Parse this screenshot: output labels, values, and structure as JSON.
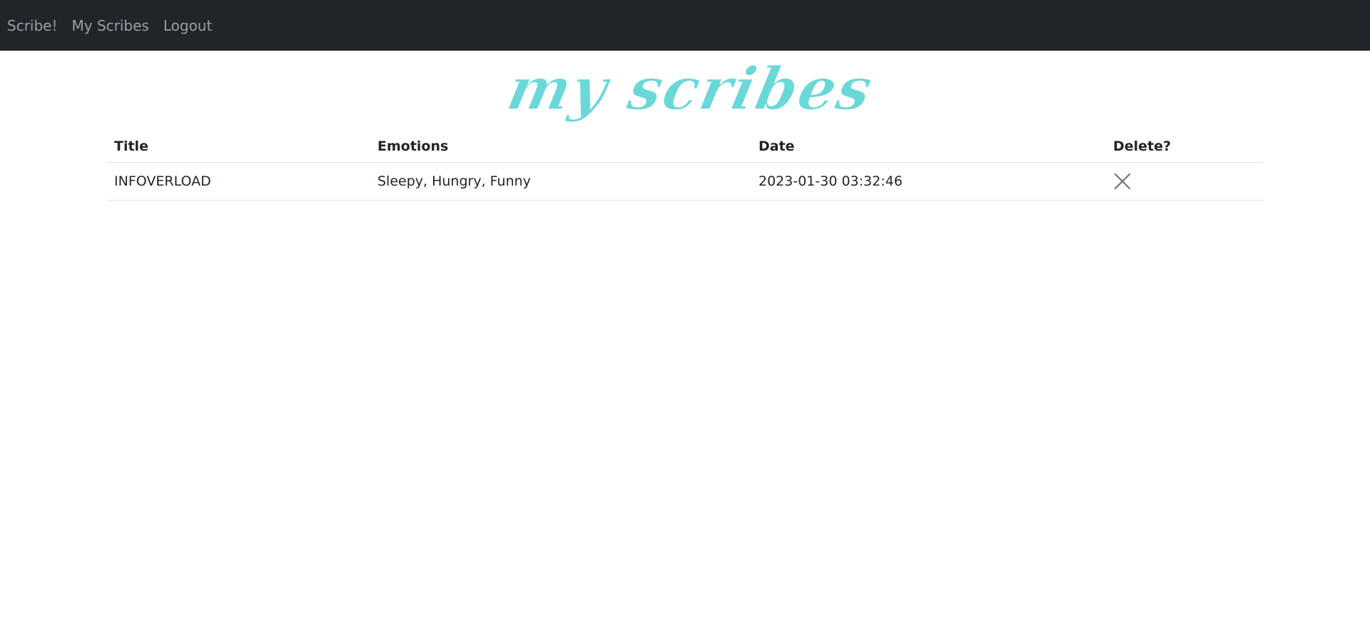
{
  "navbar": {
    "items": [
      {
        "label": "Scribe!"
      },
      {
        "label": "My Scribes"
      },
      {
        "label": "Logout"
      }
    ]
  },
  "page": {
    "heading": "my scribes",
    "heading_color": "#6ad8d9"
  },
  "table": {
    "headers": {
      "title": "Title",
      "emotions": "Emotions",
      "date": "Date",
      "delete": "Delete?"
    },
    "rows": [
      {
        "title": "INFOVERLOAD",
        "emotions": "Sleepy, Hungry, Funny",
        "date": "2023-01-30 03:32:46",
        "delete_icon": "close-icon"
      }
    ]
  },
  "colors": {
    "navbar_bg": "#212529",
    "nav_link": "rgba(255,255,255,0.55)",
    "text": "#212529",
    "border": "#dee2e6"
  }
}
